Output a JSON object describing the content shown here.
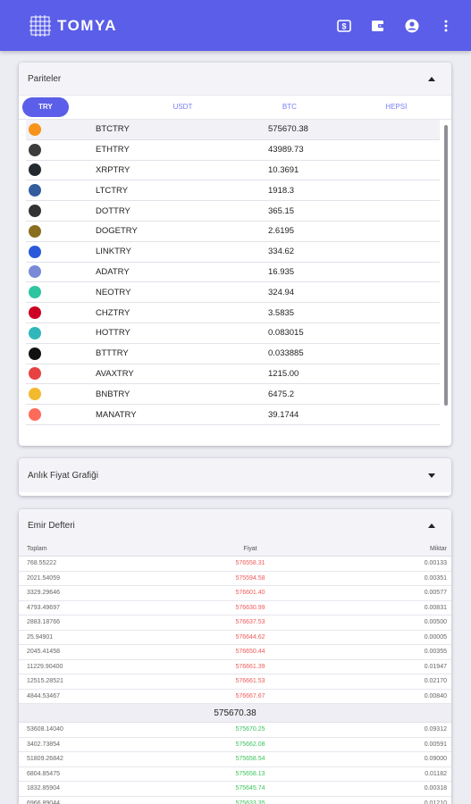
{
  "app": {
    "brand": "TOMYA",
    "brand_color": "#5a5ee8"
  },
  "topbar": {
    "icons": [
      "dollar-icon",
      "wallet-icon",
      "account-icon",
      "more-vert-icon"
    ]
  },
  "pairs_card": {
    "title": "Pariteler",
    "tabs": [
      "TRY",
      "USDT",
      "BTC",
      "HEPSİ"
    ],
    "active_tab": "TRY",
    "rows": [
      {
        "symbol": "BTCTRY",
        "price": "575670.38",
        "icon_color": "#f7931a"
      },
      {
        "symbol": "ETHTRY",
        "price": "43989.73",
        "icon_color": "#3c3c3d"
      },
      {
        "symbol": "XRPTRY",
        "price": "10.3691",
        "icon_color": "#23292f"
      },
      {
        "symbol": "LTCTRY",
        "price": "1918.3",
        "icon_color": "#345d9d"
      },
      {
        "symbol": "DOTTRY",
        "price": "365.15",
        "icon_color": "#333333"
      },
      {
        "symbol": "DOGETRY",
        "price": "2.6195",
        "icon_color": "#8a6d1e"
      },
      {
        "symbol": "LINKTRY",
        "price": "334.62",
        "icon_color": "#2a5ada"
      },
      {
        "symbol": "ADATRY",
        "price": "16.935",
        "icon_color": "#7a8ad6"
      },
      {
        "symbol": "NEOTRY",
        "price": "324.94",
        "icon_color": "#2ec5a0"
      },
      {
        "symbol": "CHZTRY",
        "price": "3.5835",
        "icon_color": "#cd0124"
      },
      {
        "symbol": "HOTTRY",
        "price": "0.083015",
        "icon_color": "#30b7b9"
      },
      {
        "symbol": "BTTTRY",
        "price": "0.033885",
        "icon_color": "#111111"
      },
      {
        "symbol": "AVAXTRY",
        "price": "1215.00",
        "icon_color": "#e84142"
      },
      {
        "symbol": "BNBTRY",
        "price": "6475.2",
        "icon_color": "#f3ba2f"
      },
      {
        "symbol": "MANATRY",
        "price": "39.1744",
        "icon_color": "#ff6b5b"
      }
    ]
  },
  "chart_card": {
    "title": "Anlık Fiyat Grafiği"
  },
  "order_book": {
    "title": "Emir Defteri",
    "columns": {
      "total": "Toplam",
      "price": "Fiyat",
      "amount": "Miktar"
    },
    "asks": [
      {
        "total": "768.55222",
        "price": "576558.31",
        "amount": "0.00133"
      },
      {
        "total": "2021.54059",
        "price": "575594.58",
        "amount": "0.00351"
      },
      {
        "total": "3329.29646",
        "price": "576601.40",
        "amount": "0.00577"
      },
      {
        "total": "4793.49697",
        "price": "576630.99",
        "amount": "0.00831"
      },
      {
        "total": "2883.18766",
        "price": "576637.53",
        "amount": "0.00500"
      },
      {
        "total": "25.94901",
        "price": "576644.62",
        "amount": "0.00005"
      },
      {
        "total": "2045.41458",
        "price": "576650.44",
        "amount": "0.00355"
      },
      {
        "total": "11229.90400",
        "price": "576661.39",
        "amount": "0.01947"
      },
      {
        "total": "12515.28521",
        "price": "576661.53",
        "amount": "0.02170"
      },
      {
        "total": "4844.53467",
        "price": "576667.67",
        "amount": "0.00840"
      }
    ],
    "mid_price": "575670.38",
    "bids": [
      {
        "total": "53608.14040",
        "price": "575670.25",
        "amount": "0.09312"
      },
      {
        "total": "3402.73854",
        "price": "575662.08",
        "amount": "0.00591"
      },
      {
        "total": "51809.26842",
        "price": "575658.54",
        "amount": "0.09000"
      },
      {
        "total": "6804.85475",
        "price": "575658.13",
        "amount": "0.01182"
      },
      {
        "total": "1832.85904",
        "price": "575645.74",
        "amount": "0.00318"
      },
      {
        "total": "6966.89044",
        "price": "575633.35",
        "amount": "0.01210"
      }
    ]
  }
}
